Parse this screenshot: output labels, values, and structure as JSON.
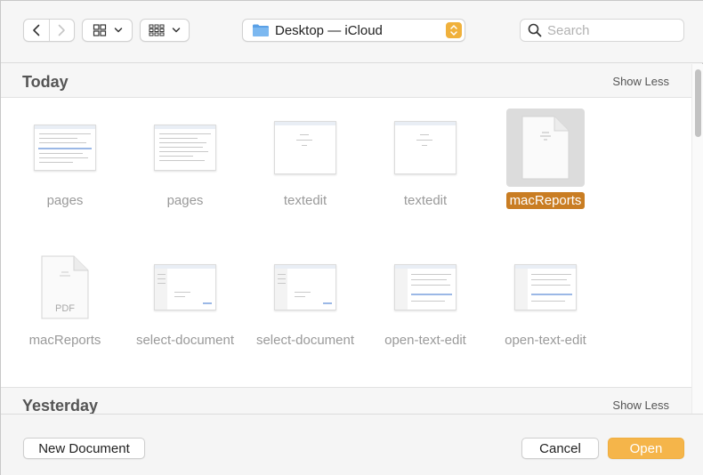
{
  "toolbar": {
    "location_label": "Desktop — iCloud",
    "search_placeholder": "Search"
  },
  "sections": {
    "today": {
      "title": "Today",
      "toggle": "Show Less"
    },
    "yesterday": {
      "title": "Yesterday",
      "toggle": "Show Less"
    }
  },
  "files": [
    {
      "name": "pages",
      "kind": "screenshot"
    },
    {
      "name": "pages",
      "kind": "screenshot"
    },
    {
      "name": "textedit",
      "kind": "screenshot"
    },
    {
      "name": "textedit",
      "kind": "screenshot"
    },
    {
      "name": "macReports",
      "kind": "document",
      "selected": true
    },
    {
      "name": "macReports",
      "kind": "pdf",
      "badge": "PDF"
    },
    {
      "name": "select-document",
      "kind": "screenshot"
    },
    {
      "name": "select-document",
      "kind": "screenshot"
    },
    {
      "name": "open-text-edit",
      "kind": "screenshot"
    },
    {
      "name": "open-text-edit",
      "kind": "screenshot"
    }
  ],
  "footer": {
    "new_document": "New Document",
    "cancel": "Cancel",
    "open": "Open"
  },
  "colors": {
    "accent": "#f5b54a",
    "selection": "#c97d23",
    "folder": "#5aa0e6"
  },
  "icons": [
    "chevron-left-icon",
    "chevron-right-icon",
    "grid-view-icon",
    "group-icon",
    "folder-icon",
    "stepper-icon",
    "search-icon"
  ]
}
